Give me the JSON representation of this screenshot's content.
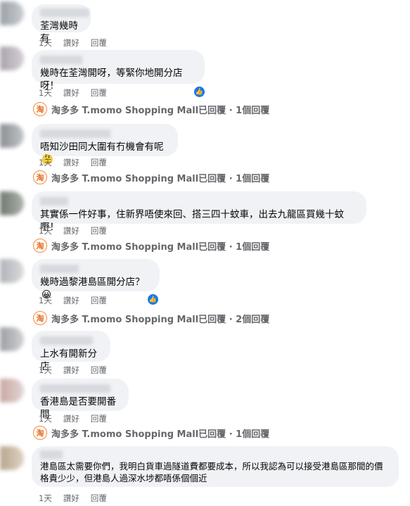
{
  "actions": {
    "like": "讚好",
    "reply": "回覆"
  },
  "page_name": "淘多多 T.momo Shopping Mall",
  "page_avatar_char": "淘",
  "comments": [
    {
      "text": "荃灣幾時有",
      "time": "1天",
      "emoji": ""
    },
    {
      "text": "幾時在荃灣開呀，等緊你地開分店呀！",
      "time": "1天",
      "emoji": "",
      "replies": "已回覆 · 1個回覆"
    },
    {
      "text": "唔知沙田同大圍有冇機會有呢",
      "time": "1天",
      "emoji": "🤔",
      "replies": "已回覆 · 1個回覆"
    },
    {
      "text": "其實係一件好事，住新界唔使來回、搭三四十蚊車，出去九龍區買幾十蚊嘢！",
      "time": "1天",
      "emoji": "",
      "replies": "已回覆 · 1個回覆"
    },
    {
      "text": "幾時過黎港島區開分店？",
      "time": "1天",
      "emoji": "😀",
      "replies": "已回覆 · 2個回覆"
    },
    {
      "text": "上水有開新分店",
      "time": "1天",
      "emoji": ""
    },
    {
      "text": "香港島是否要開番間",
      "time": "1天",
      "emoji": "",
      "replies": "已回覆 · 1個回覆"
    },
    {
      "text": "港島區太需要你們，我明白貨車過隧道費都要成本，所以我認為可以接受港島區那間的價格貴少少，但港島人過深水埗都唔係個個近",
      "time": "1天",
      "emoji": ""
    }
  ]
}
